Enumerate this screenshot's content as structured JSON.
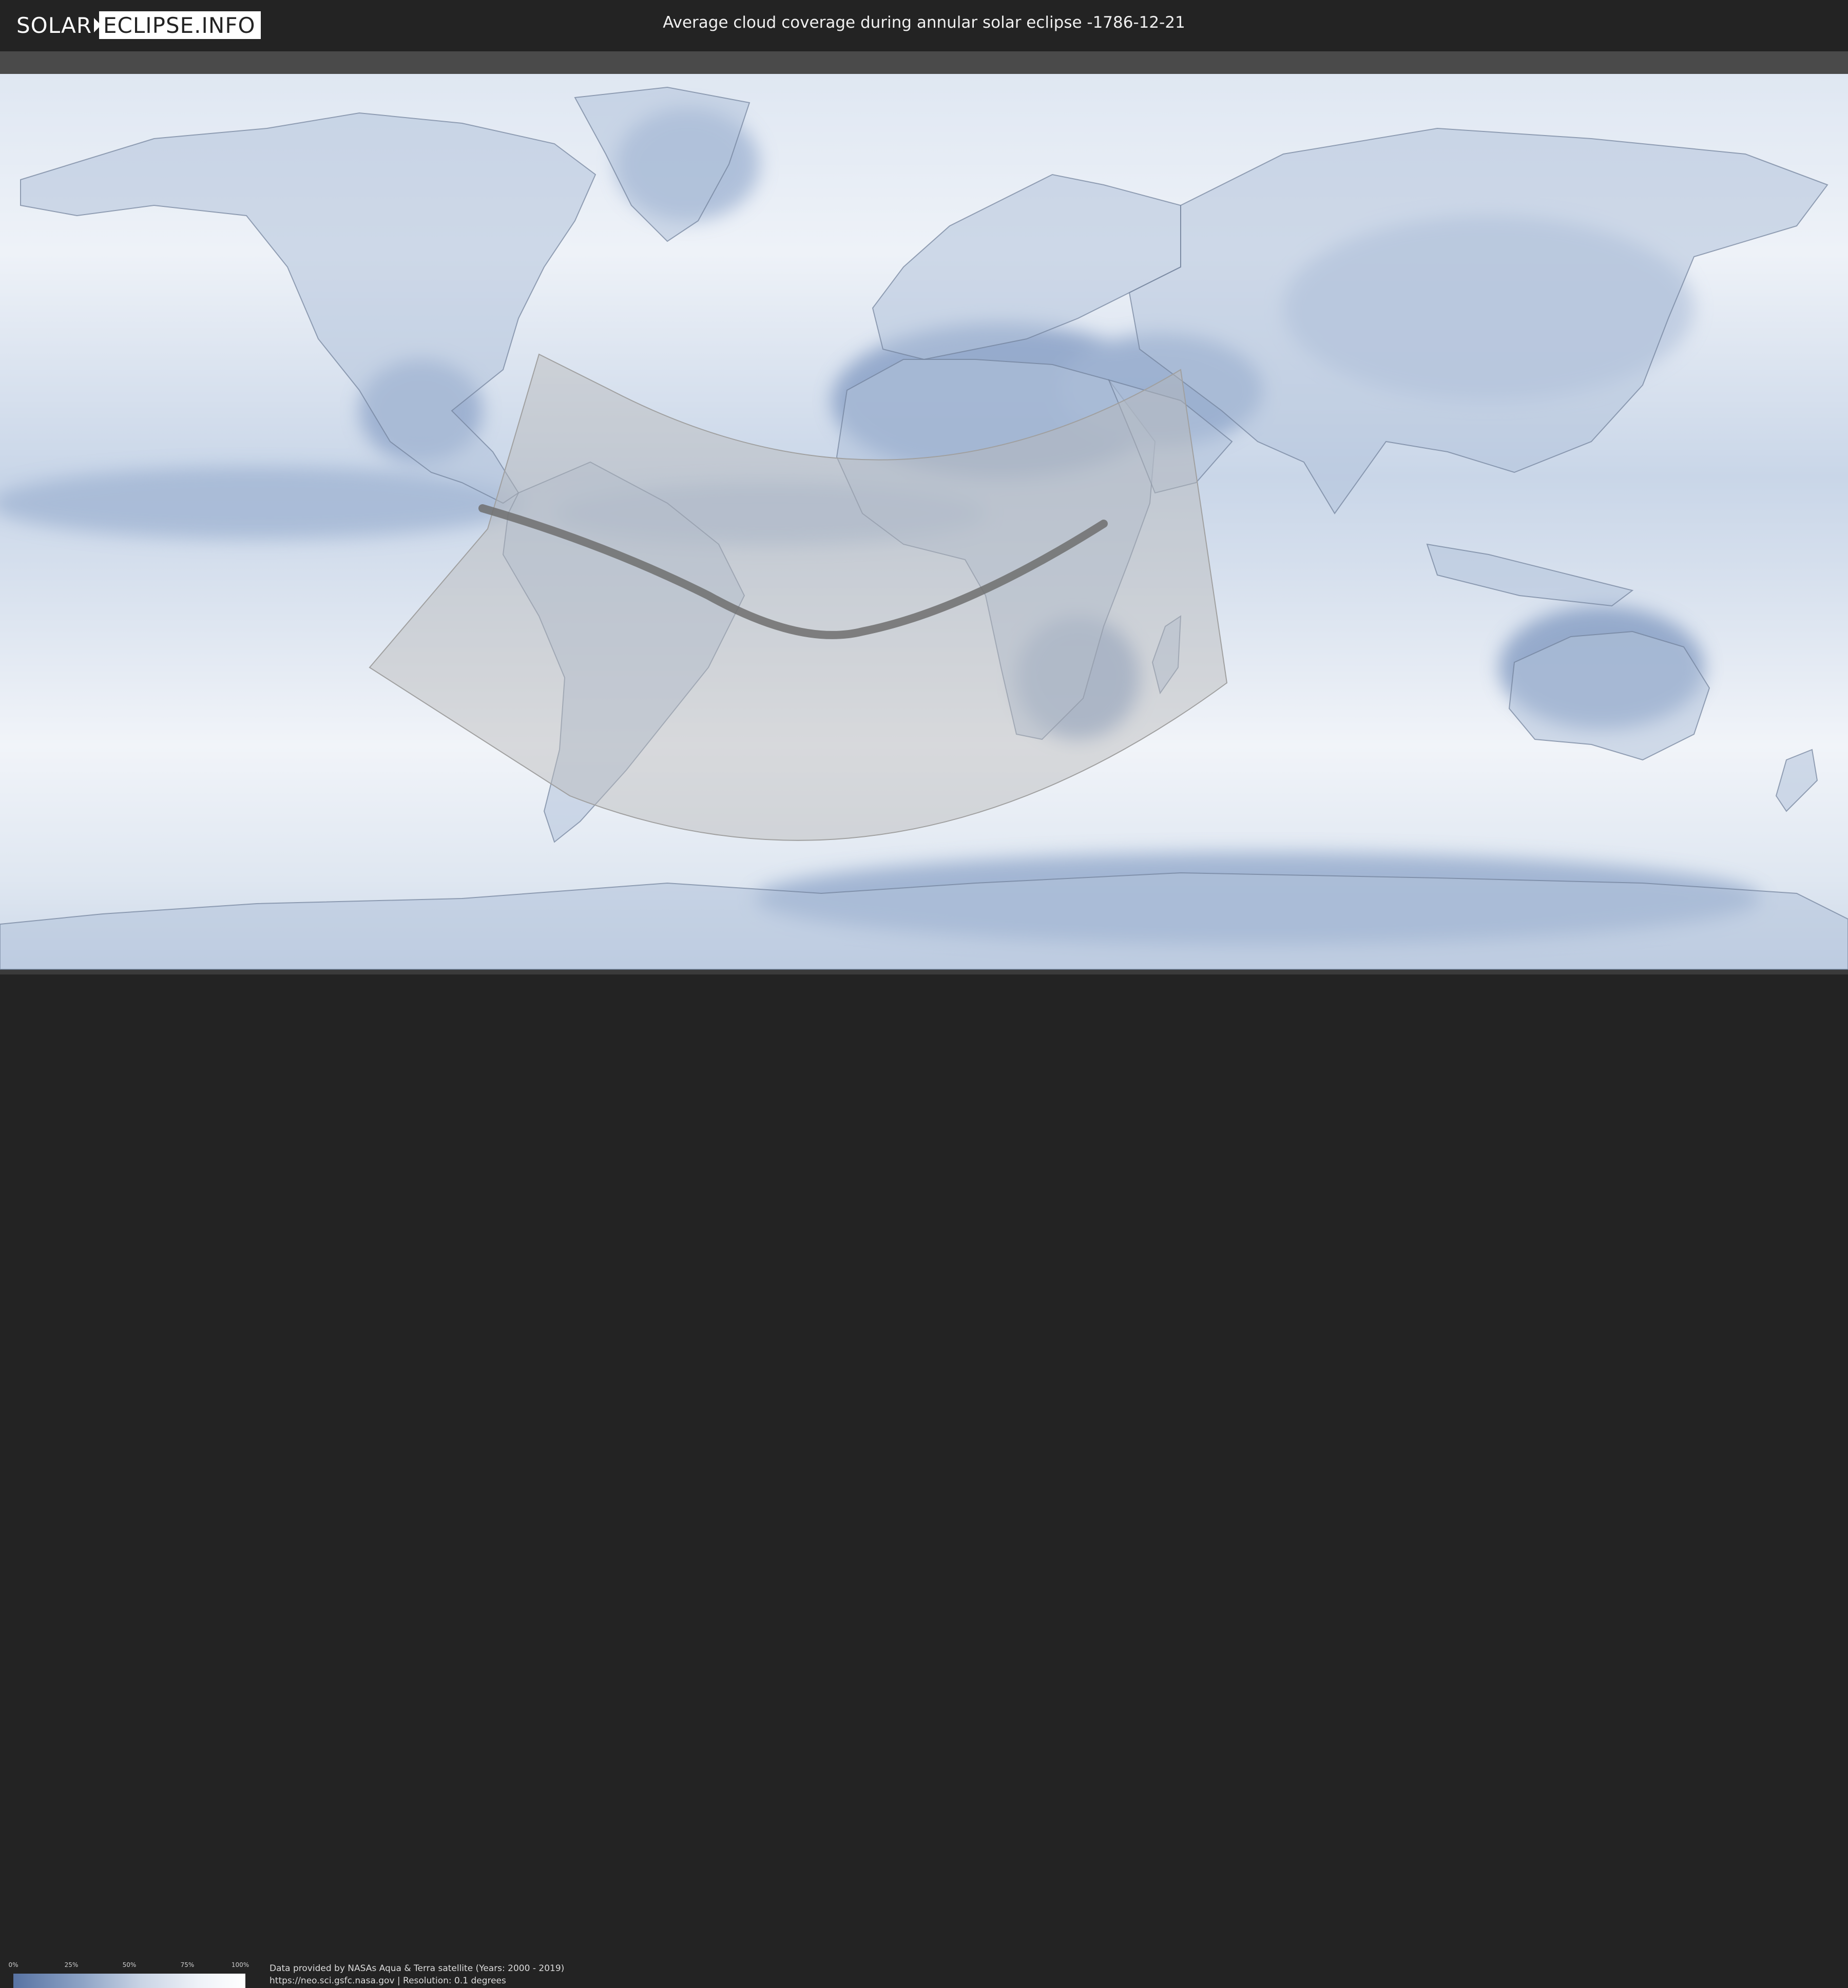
{
  "header": {
    "logo_left": "SOLAR",
    "logo_right": "ECLIPSE.INFO",
    "title": "Average cloud coverage during annular solar eclipse -1786-12-21"
  },
  "legend": {
    "ticks": [
      "0%",
      "25%",
      "50%",
      "75%",
      "100%"
    ],
    "colors": {
      "low": "#5873a3",
      "high": "#ffffff"
    }
  },
  "credits": {
    "line1": "Data provided by NASAs Aqua & Terra satellite (Years: 2000 - 2019)",
    "line2": "https://neo.sci.gsfc.nasa.gov | Resolution: 0.1 degrees"
  },
  "colors": {
    "header_bg": "#232323",
    "cloud_blue": "#6f8ab8",
    "land_outline": "#7d8aa0",
    "penumbra_fill": "#b7b7b7",
    "central_path": "#6e6e6e"
  }
}
